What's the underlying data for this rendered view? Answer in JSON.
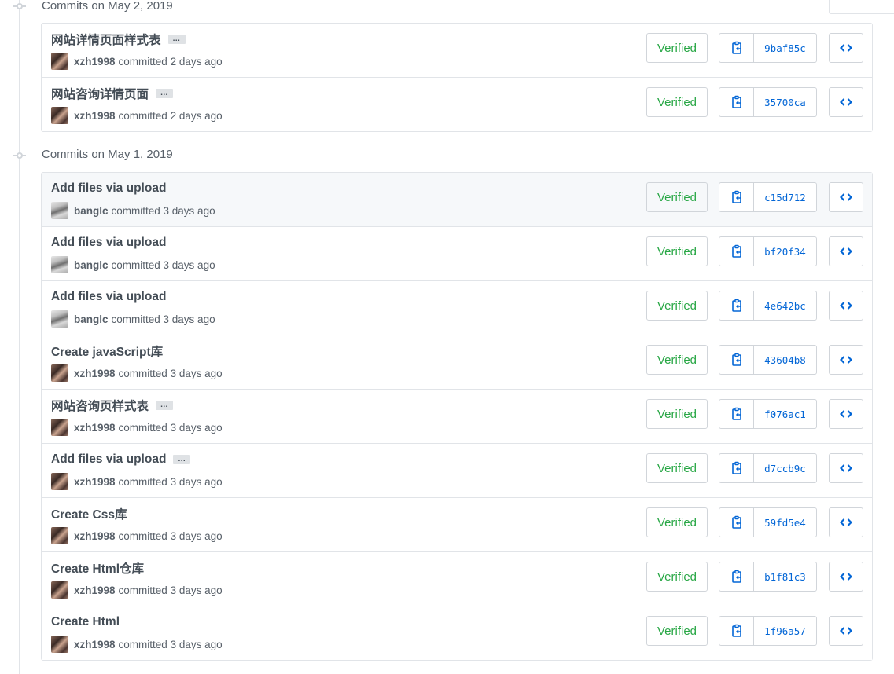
{
  "groups": [
    {
      "title": "Commits on May 2, 2019",
      "commits": [
        {
          "message": "网站详情页面样式表",
          "has_ellipsis": true,
          "author": "xzh1998",
          "rest": "committed 2 days ago",
          "avatar": "a1",
          "verified": "Verified",
          "sha": "9baf85c",
          "highlight": false
        },
        {
          "message": "网站咨询详情页面",
          "has_ellipsis": true,
          "author": "xzh1998",
          "rest": "committed 2 days ago",
          "avatar": "a1",
          "verified": "Verified",
          "sha": "35700ca",
          "highlight": false
        }
      ]
    },
    {
      "title": "Commits on May 1, 2019",
      "commits": [
        {
          "message": "Add files via upload",
          "has_ellipsis": false,
          "author": "banglc",
          "rest": "committed 3 days ago",
          "avatar": "a2",
          "verified": "Verified",
          "sha": "c15d712",
          "highlight": true
        },
        {
          "message": "Add files via upload",
          "has_ellipsis": false,
          "author": "banglc",
          "rest": "committed 3 days ago",
          "avatar": "a2",
          "verified": "Verified",
          "sha": "bf20f34",
          "highlight": false
        },
        {
          "message": "Add files via upload",
          "has_ellipsis": false,
          "author": "banglc",
          "rest": "committed 3 days ago",
          "avatar": "a2",
          "verified": "Verified",
          "sha": "4e642bc",
          "highlight": false
        },
        {
          "message": "Create javaScript库",
          "has_ellipsis": false,
          "author": "xzh1998",
          "rest": "committed 3 days ago",
          "avatar": "a1",
          "verified": "Verified",
          "sha": "43604b8",
          "highlight": false
        },
        {
          "message": "网站咨询页样式表",
          "has_ellipsis": true,
          "author": "xzh1998",
          "rest": "committed 3 days ago",
          "avatar": "a1",
          "verified": "Verified",
          "sha": "f076ac1",
          "highlight": false
        },
        {
          "message": "Add files via upload",
          "has_ellipsis": true,
          "author": "xzh1998",
          "rest": "committed 3 days ago",
          "avatar": "a1",
          "verified": "Verified",
          "sha": "d7ccb9c",
          "highlight": false
        },
        {
          "message": "Create Css库",
          "has_ellipsis": false,
          "author": "xzh1998",
          "rest": "committed 3 days ago",
          "avatar": "a1",
          "verified": "Verified",
          "sha": "59fd5e4",
          "highlight": false
        },
        {
          "message": "Create Html仓库",
          "has_ellipsis": false,
          "author": "xzh1998",
          "rest": "committed 3 days ago",
          "avatar": "a1",
          "verified": "Verified",
          "sha": "b1f81c3",
          "highlight": false
        },
        {
          "message": "Create Html",
          "has_ellipsis": false,
          "author": "xzh1998",
          "rest": "committed 3 days ago",
          "avatar": "a1",
          "verified": "Verified",
          "sha": "1f96a57",
          "highlight": false
        }
      ]
    }
  ],
  "icons": {
    "commit_node": "git-commit-icon",
    "copy": "clipboard-copy-icon",
    "browse": "code-browse-icon"
  },
  "colors": {
    "verified": "#28a745",
    "sha_link": "#0366d6",
    "border": "#e1e4e8",
    "highlight_row": "#f6f8fa"
  }
}
